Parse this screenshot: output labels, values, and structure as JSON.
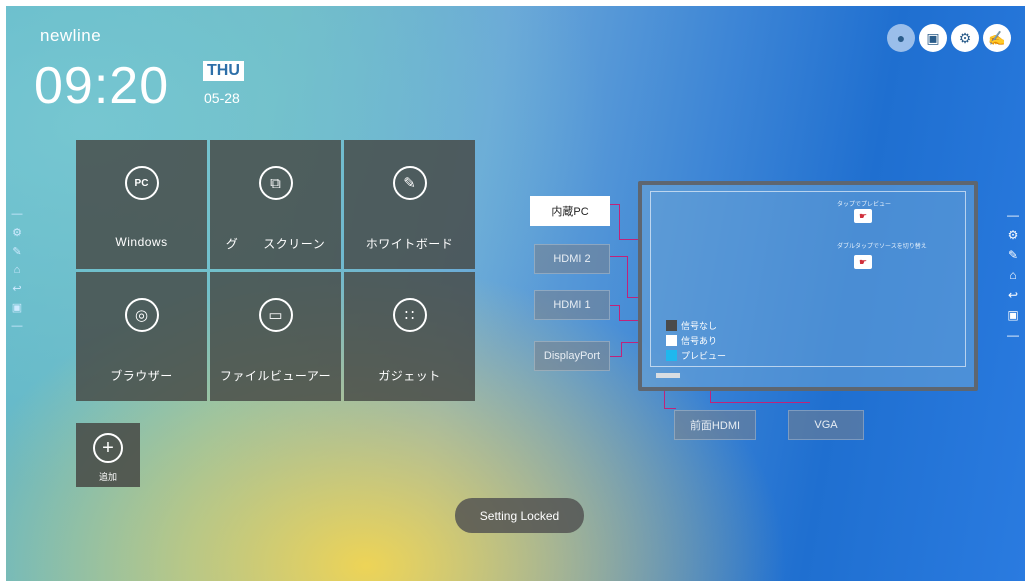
{
  "brand": "newline",
  "clock": {
    "time": "09:20",
    "day": "THU",
    "date": "05-28"
  },
  "tiles": [
    {
      "name": "windows",
      "label": "Windows",
      "icon": "pc-icon",
      "glyph": "PC"
    },
    {
      "name": "screen",
      "label": "グ　　スクリーン",
      "icon": "screen-share-icon",
      "glyph": "⧉"
    },
    {
      "name": "whiteboard",
      "label": "ホワイトボード",
      "icon": "pen-icon",
      "glyph": "✎"
    },
    {
      "name": "browser",
      "label": "ブラウザー",
      "icon": "globe-icon",
      "glyph": "◎"
    },
    {
      "name": "file-viewer",
      "label": "ファイルビューアー",
      "icon": "folder-icon",
      "glyph": "▭"
    },
    {
      "name": "gadget",
      "label": "ガジェット",
      "icon": "apps-grid-icon",
      "glyph": "∷"
    }
  ],
  "add_tile": {
    "label": "追加",
    "glyph": "+"
  },
  "top_icons": [
    {
      "name": "user-icon",
      "glyph": "●"
    },
    {
      "name": "input-settings-icon",
      "glyph": "▣"
    },
    {
      "name": "gear-icon",
      "glyph": "⚙"
    },
    {
      "name": "note-icon",
      "glyph": "✍"
    }
  ],
  "sources": {
    "internal_pc": "内蔵PC",
    "hdmi2": "HDMI 2",
    "hdmi1": "HDMI 1",
    "displayport": "DisplayPort",
    "front_hdmi": "前面HDMI",
    "vga": "VGA"
  },
  "legend": {
    "no_signal": "信号なし",
    "has_signal": "信号あり",
    "preview": "プレビュー"
  },
  "hints": {
    "tap_preview": "タップでプレビュー",
    "double_tap": "ダブルタップでソースを切り替え"
  },
  "colors": {
    "no_signal": "#4a4a4a",
    "has_signal": "#ffffff",
    "preview": "#1fb8ee",
    "connector": "#c0237a"
  },
  "toast": "Setting Locked"
}
